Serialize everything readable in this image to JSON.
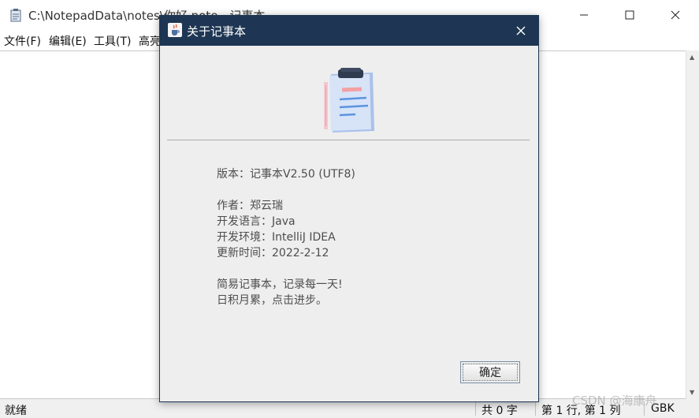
{
  "window": {
    "title": "C:\\NotepadData\\notes\\你好.note - 记事本",
    "controls": [
      "minimize-icon",
      "maximize-icon",
      "close-icon"
    ]
  },
  "menu": {
    "items": [
      "文件(F)",
      "编辑(E)",
      "工具(T)",
      "高亮"
    ]
  },
  "status": {
    "ready": "就绪",
    "count": "共 0 字",
    "position": "第 1 行, 第 1 列",
    "encoding": "GBK"
  },
  "watermark": "CSDN @海康舟",
  "dialog": {
    "title": "关于记事本",
    "version": "版本：记事本V2.50 (UTF8)",
    "author": "作者：郑云瑞",
    "language": "开发语言：Java",
    "environment": "开发环境：IntelliJ IDEA",
    "updated": "更新时间：2022-2-12",
    "slogan_line1": "简易记事本，记录每一天!",
    "slogan_line2": "日积月累，点击进步。",
    "ok_label": "确定",
    "illustration": "clipboard-notes-icon"
  },
  "colors": {
    "dialog_title_bg": "#1e3653",
    "dialog_bg": "#eeeeee",
    "info_text": "#4d4d4d"
  }
}
